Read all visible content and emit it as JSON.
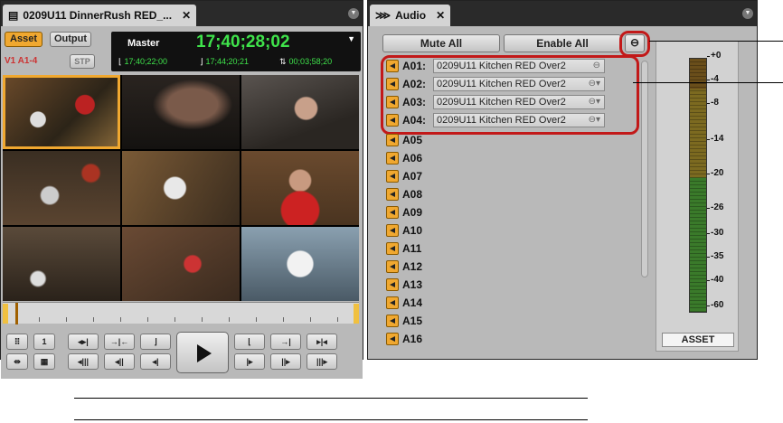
{
  "left_panel": {
    "tab_title": "0209U11 DinnerRush RED_...",
    "tab_close": "✕",
    "asset_btn": "Asset",
    "output_btn": "Output",
    "tracks": "V1 A1-4",
    "stp_btn": "STP",
    "tc_label": "Master",
    "tc_main": "17;40;28;02",
    "tc_in": "17;40;22;00",
    "tc_out": "17;44;20;21",
    "tc_dur": "00;03;58;20",
    "ctrl": {
      "num": "1"
    }
  },
  "audio_panel": {
    "tab_title": "Audio",
    "tab_close": "✕",
    "mute_all": "Mute All",
    "enable_all": "Enable All",
    "link_icon": "⊖",
    "tracks": [
      {
        "name": "A01:",
        "clip": "0209U11 Kitchen RED Over2"
      },
      {
        "name": "A02:",
        "clip": "0209U11 Kitchen RED Over2"
      },
      {
        "name": "A03:",
        "clip": "0209U11 Kitchen RED Over2"
      },
      {
        "name": "A04:",
        "clip": "0209U11 Kitchen RED Over2"
      },
      {
        "name": "A05"
      },
      {
        "name": "A06"
      },
      {
        "name": "A07"
      },
      {
        "name": "A08"
      },
      {
        "name": "A09"
      },
      {
        "name": "A10"
      },
      {
        "name": "A11"
      },
      {
        "name": "A12"
      },
      {
        "name": "A13"
      },
      {
        "name": "A14"
      },
      {
        "name": "A15"
      },
      {
        "name": "A16"
      }
    ],
    "meter_scale": [
      "+0",
      "-4",
      "-8",
      "-14",
      "-20",
      "-26",
      "-30",
      "-35",
      "-40",
      "-60"
    ],
    "meter_label": "ASSET"
  }
}
